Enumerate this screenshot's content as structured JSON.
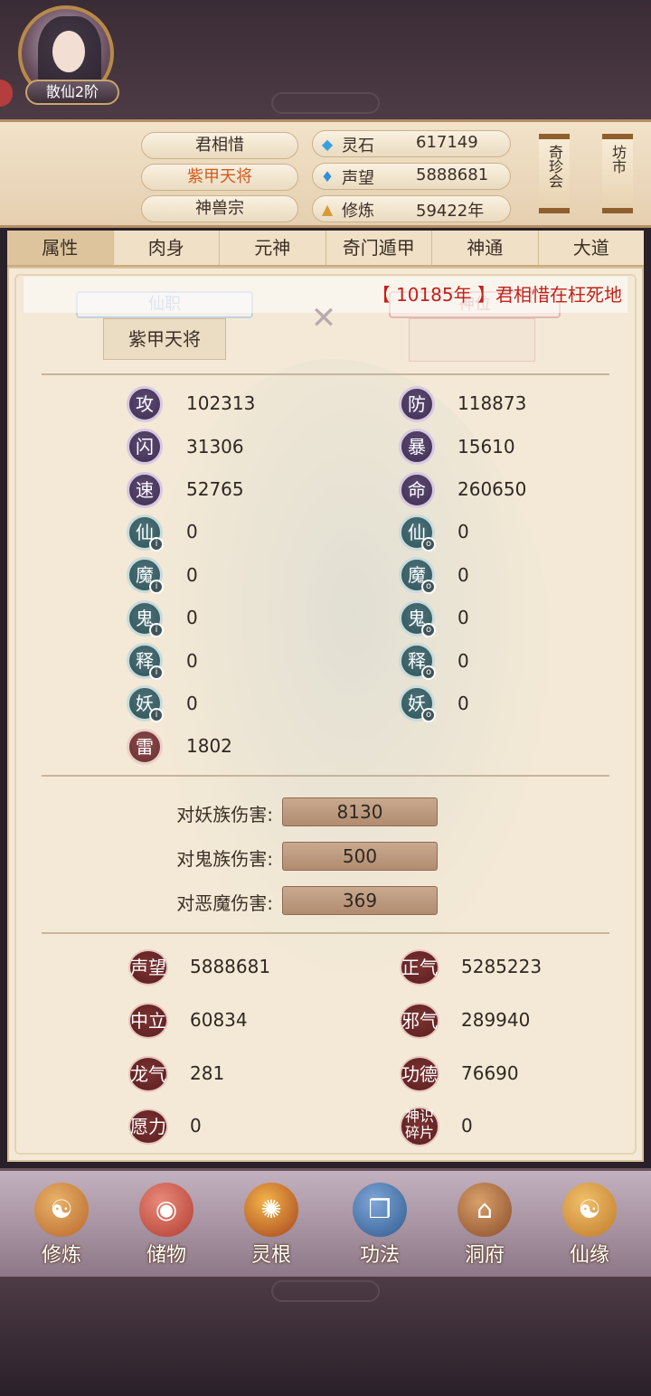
{
  "header": {
    "rank": "散仙2阶",
    "name": "君相惜",
    "title": "紫甲天将",
    "sect": "神兽宗",
    "resources": [
      {
        "icon": "spirit-stone-icon",
        "label": "灵石",
        "value": "617149"
      },
      {
        "icon": "reputation-icon",
        "label": "声望",
        "value": "5888681"
      },
      {
        "icon": "cultivation-icon",
        "label": "修炼",
        "value": "59422年"
      }
    ],
    "side_buttons": [
      "奇珍会",
      "坊市"
    ]
  },
  "tabs": [
    {
      "label": "属性",
      "active": true
    },
    {
      "label": "肉身",
      "active": false
    },
    {
      "label": "元神",
      "active": false
    },
    {
      "label": "奇门遁甲",
      "active": false
    },
    {
      "label": "神通",
      "active": false
    },
    {
      "label": "大道",
      "active": false
    }
  ],
  "ticker": "【 10185年 】君相惜在枉死地",
  "ranks": {
    "xianzhi_label": "仙职",
    "shenwei_label": "神位",
    "xianzhi_value": "紫甲天将"
  },
  "stats_left": [
    {
      "glyph": "攻",
      "value": "102313",
      "style": "purple"
    },
    {
      "glyph": "闪",
      "value": "31306",
      "style": "purple"
    },
    {
      "glyph": "速",
      "value": "52765",
      "style": "purple"
    },
    {
      "glyph": "仙",
      "value": "0",
      "style": "teal"
    },
    {
      "glyph": "魔",
      "value": "0",
      "style": "teal"
    },
    {
      "glyph": "鬼",
      "value": "0",
      "style": "teal"
    },
    {
      "glyph": "释",
      "value": "0",
      "style": "teal"
    },
    {
      "glyph": "妖",
      "value": "0",
      "style": "teal"
    },
    {
      "glyph": "雷",
      "value": "1802",
      "style": "red"
    }
  ],
  "stats_right": [
    {
      "glyph": "防",
      "value": "118873",
      "style": "purple"
    },
    {
      "glyph": "暴",
      "value": "15610",
      "style": "purple"
    },
    {
      "glyph": "命",
      "value": "260650",
      "style": "purple"
    },
    {
      "glyph": "仙",
      "value": "0",
      "style": "teal"
    },
    {
      "glyph": "魔",
      "value": "0",
      "style": "teal"
    },
    {
      "glyph": "鬼",
      "value": "0",
      "style": "teal"
    },
    {
      "glyph": "释",
      "value": "0",
      "style": "teal"
    },
    {
      "glyph": "妖",
      "value": "0",
      "style": "teal"
    }
  ],
  "damage": [
    {
      "label": "对妖族伤害:",
      "value": "8130"
    },
    {
      "label": "对鬼族伤害:",
      "value": "500"
    },
    {
      "label": "对恶魔伤害:",
      "value": "369"
    }
  ],
  "reputation_left": [
    {
      "label": "声望",
      "value": "5888681"
    },
    {
      "label": "中立",
      "value": "60834"
    },
    {
      "label": "龙气",
      "value": "281"
    },
    {
      "label": "愿力",
      "value": "0"
    }
  ],
  "reputation_right": [
    {
      "label": "正气",
      "value": "5285223"
    },
    {
      "label": "邪气",
      "value": "289940"
    },
    {
      "label": "功德",
      "value": "76690"
    },
    {
      "label": "神识碎片",
      "value": "0"
    }
  ],
  "bottom_nav": [
    {
      "label": "修炼",
      "icon": "meditating-figure-icon"
    },
    {
      "label": "储物",
      "icon": "storage-bag-icon"
    },
    {
      "label": "灵根",
      "icon": "spirit-root-icon"
    },
    {
      "label": "功法",
      "icon": "scripture-book-icon"
    },
    {
      "label": "洞府",
      "icon": "cave-palace-icon"
    },
    {
      "label": "仙缘",
      "icon": "gourd-icon"
    }
  ],
  "colors": {
    "accent": "#d35a1e",
    "ticker": "#c2221a"
  }
}
